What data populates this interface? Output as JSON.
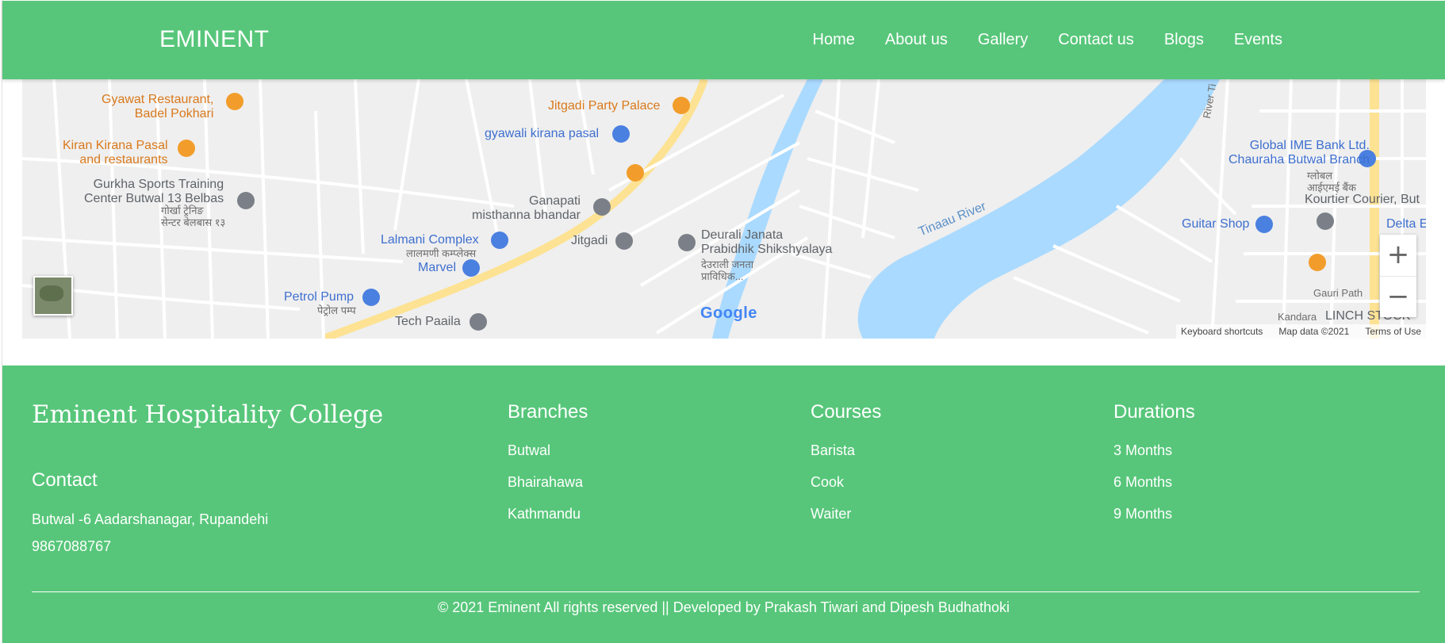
{
  "header": {
    "brand": "EMINENT",
    "nav": [
      "Home",
      "About us",
      "Gallery",
      "Contact us",
      "Blogs",
      "Events"
    ]
  },
  "map": {
    "places": [
      {
        "text": "Gyawat Restaurant,\nBadel Pokhari",
        "kind": "orange"
      },
      {
        "text": "Kiran Kirana Pasal\nand restaurants",
        "kind": "orange"
      },
      {
        "text": "Gurkha Sports Training\nCenter Butwal 13 Belbas",
        "kind": "gray"
      },
      {
        "text": "गोर्खा ट्रेनिङ\nसेन्टर बेलबास १३",
        "kind": "small"
      },
      {
        "text": "Jitgadi Party Palace",
        "kind": "orange"
      },
      {
        "text": "gyawali kirana pasal",
        "kind": "blue"
      },
      {
        "text": "Ganapati\nmisthanna bhandar",
        "kind": "gray"
      },
      {
        "text": "Lalmani Complex",
        "kind": "blue"
      },
      {
        "text": "लालमणी कम्प्लेक्स",
        "kind": "small"
      },
      {
        "text": "Jitgadi",
        "kind": "gray"
      },
      {
        "text": "Deurali Janata\nPrabidhik Shikshyalaya",
        "kind": "gray"
      },
      {
        "text": "देउराली जनता\nप्राविधिक...",
        "kind": "small"
      },
      {
        "text": "Marvel",
        "kind": "blue"
      },
      {
        "text": "Petrol Pump",
        "kind": "blue"
      },
      {
        "text": "पेट्रोल पम्प",
        "kind": "small"
      },
      {
        "text": "Tech Paaila",
        "kind": "gray"
      },
      {
        "text": "Global IME Bank Ltd.\nChauraha Butwal Branch",
        "kind": "blue"
      },
      {
        "text": "ग्लोबल\nआईएमई बैंक",
        "kind": "small"
      },
      {
        "text": "Kourtier Courier, But",
        "kind": "gray"
      },
      {
        "text": "Guitar Shop",
        "kind": "blue"
      },
      {
        "text": "Delta E",
        "kind": "blue"
      },
      {
        "text": "Gauri Path",
        "kind": "small"
      },
      {
        "text": "Kandara",
        "kind": "small"
      },
      {
        "text": "LINCH STOCK",
        "kind": "gray"
      },
      {
        "text": "River Ti",
        "kind": "small"
      }
    ],
    "river_label": "Tinaau River",
    "google_logo": "Google",
    "zoom_in": "+",
    "zoom_out": "−",
    "footer_links": [
      "Keyboard shortcuts",
      "Map data ©2021",
      "Terms of Use"
    ]
  },
  "footer": {
    "college": "Eminent Hospitality College",
    "contact_title": "Contact",
    "address": "Butwal -6 Aadarshanagar, Rupandehi",
    "phone": "9867088767",
    "branches": {
      "title": "Branches",
      "items": [
        "Butwal",
        "Bhairahawa",
        "Kathmandu"
      ]
    },
    "courses": {
      "title": "Courses",
      "items": [
        "Barista",
        "Cook",
        "Waiter"
      ]
    },
    "durations": {
      "title": "Durations",
      "items": [
        "3 Months",
        "6 Months",
        "9 Months"
      ]
    },
    "copyright": "© 2021 Eminent All rights reserved || Developed by Prakash Tiwari and Dipesh Budhathoki"
  },
  "colors": {
    "brand_green": "#57c67a",
    "map_road": "#ffffff",
    "map_river": "#aadaff",
    "map_highway": "#fde293",
    "poi_orange": "#d9791b",
    "poi_blue": "#3e6fcf",
    "poi_gray": "#5f6368"
  }
}
